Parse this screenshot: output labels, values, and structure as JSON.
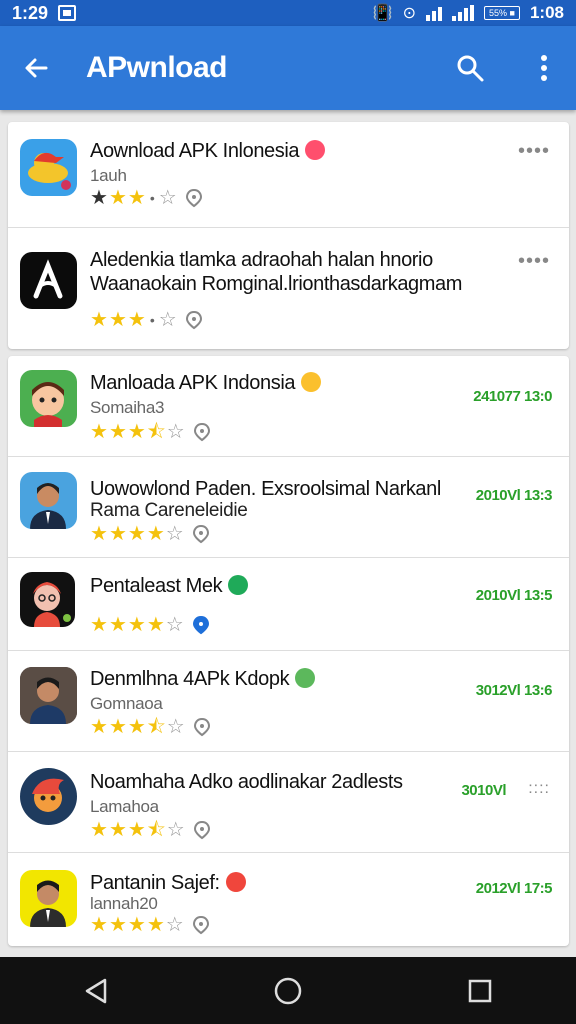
{
  "status": {
    "time": "1:29",
    "clock": "1:08",
    "battery": "55% ■"
  },
  "appbar": {
    "title": "APwnload",
    "back_icon": "arrow-left-icon",
    "search_icon": "search-icon",
    "more_icon": "more-vert-icon"
  },
  "apps": [
    {
      "name": "Aownload APK Inlonesia",
      "sub": "1auh",
      "rating_text": "",
      "date": "",
      "menu": "••••"
    },
    {
      "name": "Aledenkia tlamka adraohah halan hnorio",
      "name2": "Waanaokain Romginal.lrionthasdarkagmam",
      "sub": "",
      "date": "",
      "menu": "••••"
    },
    {
      "name": "Manloada APK Indonsia",
      "sub": "Somaiha3",
      "date": "241077 13:0"
    },
    {
      "name": "Uowowlond Paden. Exsroolsimal Narkanl",
      "sub": "Rama Careneleidie",
      "date": "2010Vl 13:3"
    },
    {
      "name": "Pentaleast Mek",
      "sub": "",
      "date": "2010Vl 13:5"
    },
    {
      "name": "Denmlhna 4APk Kdopk",
      "sub": "Gomnaoa",
      "date": "3012Vl 13:6"
    },
    {
      "name": "Noamhaha Adko aodlinakar 2adlests",
      "sub": "Lamahoa",
      "date": "3010Vl",
      "menu": "::::"
    },
    {
      "name": "Pantanin Sajef:",
      "sub": "lannah20",
      "date": "2012Vl 17:5"
    }
  ],
  "colors": {
    "appbar": "#2f79d8",
    "statusbar": "#1e5fbf",
    "star": "#f4c20d",
    "date": "#2aa02a"
  },
  "navbar": {
    "back_icon": "nav-back-icon",
    "home_icon": "nav-home-icon",
    "recents_icon": "nav-recents-icon"
  }
}
